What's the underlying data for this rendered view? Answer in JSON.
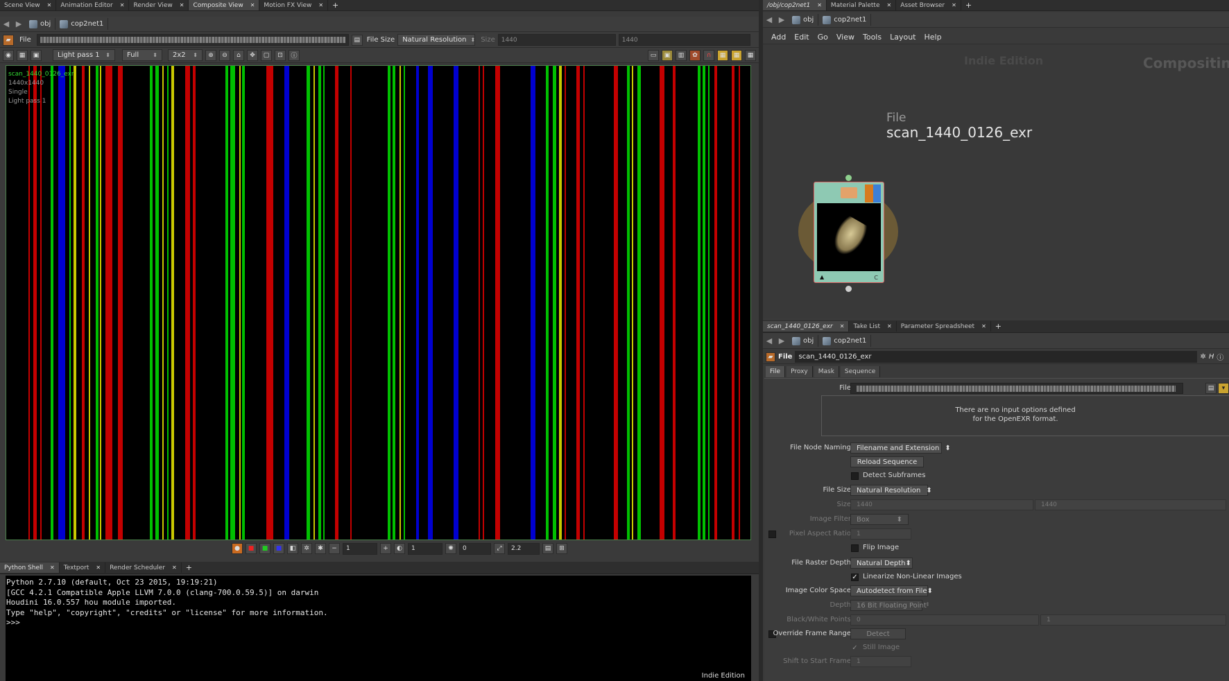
{
  "left": {
    "tabs": [
      {
        "label": "Scene View",
        "active": false
      },
      {
        "label": "Animation Editor",
        "active": false
      },
      {
        "label": "Render View",
        "active": false
      },
      {
        "label": "Composite View",
        "active": true
      },
      {
        "label": "Motion FX View",
        "active": false
      }
    ],
    "path": {
      "obj": "obj",
      "net": "cop2net1"
    },
    "file_row": {
      "file_label": "File",
      "file_size_label": "File Size",
      "file_size_value": "Natural Resolution",
      "size_label": "Size",
      "size_x": "1440",
      "size_y": "1440"
    },
    "view_row": {
      "plane": "Light pass 1",
      "res": "Full",
      "grid": "2x2"
    },
    "viewer_info": {
      "name": "scan_1440_0126_exr",
      "resolution": "1440x1440",
      "mode": "Single",
      "plane": "Light pass 1"
    },
    "bottom_controls": {
      "frame": "1",
      "exposure": "1",
      "offset": "0",
      "gamma": "2.2"
    },
    "console_tabs": [
      {
        "label": "Python Shell",
        "active": true
      },
      {
        "label": "Textport",
        "active": false
      },
      {
        "label": "Render Scheduler",
        "active": false
      }
    ],
    "console_lines": [
      "Python 2.7.10 (default, Oct 23 2015, 19:19:21)",
      "[GCC 4.2.1 Compatible Apple LLVM 7.0.0 (clang-700.0.59.5)] on darwin",
      "Houdini 16.0.557 hou module imported.",
      "Type \"help\", \"copyright\", \"credits\" or \"license\" for more information.",
      ">>>"
    ],
    "edition": "Indie Edition"
  },
  "right_top": {
    "tabs": [
      {
        "label": "/obj/cop2net1",
        "active": true
      },
      {
        "label": "Material Palette",
        "active": false
      },
      {
        "label": "Asset Browser",
        "active": false
      }
    ],
    "path": {
      "obj": "obj",
      "net": "cop2net1"
    },
    "menu": [
      "Add",
      "Edit",
      "Go",
      "View",
      "Tools",
      "Layout",
      "Help"
    ],
    "watermark": "Indie Edition",
    "context": "Compositin",
    "node": {
      "type": "File",
      "name": "scan_1440_0126_exr",
      "flag": "C"
    }
  },
  "right_bottom": {
    "tabs": [
      {
        "label": "scan_1440_0126_exr",
        "active": true
      },
      {
        "label": "Take List",
        "active": false
      },
      {
        "label": "Parameter Spreadsheet",
        "active": false
      }
    ],
    "path": {
      "obj": "obj",
      "net": "cop2net1"
    },
    "node_type": "File",
    "node_name": "scan_1440_0126_exr",
    "param_tabs": [
      {
        "label": "File",
        "active": true
      },
      {
        "label": "Proxy",
        "active": false
      },
      {
        "label": "Mask",
        "active": false
      },
      {
        "label": "Sequence",
        "active": false
      }
    ],
    "params": {
      "file_label": "File",
      "info_line1": "There are no input options defined",
      "info_line2": "for the OpenEXR format.",
      "naming_label": "File Node Naming",
      "naming_value": "Filename and Extension",
      "reload": "Reload Sequence",
      "detect_subframes": "Detect Subframes",
      "file_size_label": "File Size",
      "file_size_value": "Natural Resolution",
      "size_label": "Size",
      "size_x": "1440",
      "size_y": "1440",
      "filter_label": "Image Filter",
      "filter_value": "Box",
      "pixel_aspect_label": "Pixel Aspect Ratio",
      "pixel_aspect_value": "1",
      "flip": "Flip Image",
      "raster_label": "File Raster Depth",
      "raster_value": "Natural Depth",
      "linearize": "Linearize Non-Linear Images",
      "colorspace_label": "Image Color Space",
      "colorspace_value": "Autodetect from File",
      "depth_label": "Depth",
      "depth_value": "16 Bit Floating Point",
      "bw_label": "Black/White Points",
      "bw_black": "0",
      "bw_white": "1",
      "override_label": "Override Frame Range",
      "detect": "Detect",
      "still": "Still Image",
      "shift_label": "Shift to Start Frame",
      "shift_value": "1"
    }
  },
  "colors": {
    "red": "#c40000",
    "green": "#00c000",
    "blue": "#0000d0",
    "yellow": "#c8c800",
    "node_teal": "#8ec9b3"
  }
}
